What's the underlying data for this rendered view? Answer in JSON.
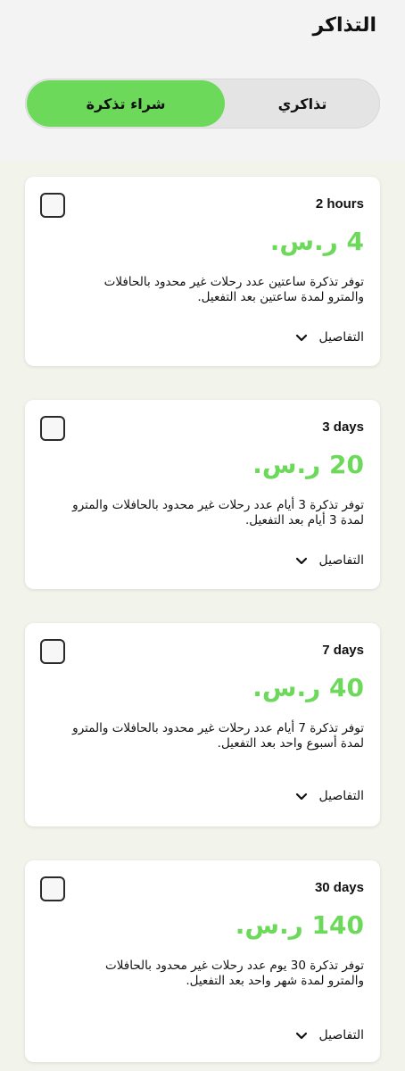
{
  "header": {
    "title": "التذاكر",
    "tabs": {
      "my_tickets": "تذاكري",
      "buy_ticket": "شراء تذكرة"
    },
    "active_tab": "buy_ticket"
  },
  "colors": {
    "accent": "#6cd95a",
    "header_bg": "#f3f3f3",
    "content_bg": "#f2f4ec"
  },
  "tickets": [
    {
      "duration": "2 hours",
      "price": "4 ر.س.",
      "description": "توفر تذكرة ساعتين عدد رحلات غير محدود بالحافلات والمترو لمدة ساعتين بعد التفعيل.",
      "details_label": "التفاصيل",
      "selected": false
    },
    {
      "duration": "3 days",
      "price": "20 ر.س.",
      "description": "توفر تذكرة 3 أيام عدد رحلات غير محدود بالحافلات والمترو لمدة 3 أيام بعد التفعيل.",
      "details_label": "التفاصيل",
      "selected": false
    },
    {
      "duration": "7 days",
      "price": "40 ر.س.",
      "description": "توفر تذكرة 7 أيام عدد رحلات غير محدود بالحافلات والمترو لمدة أسبوع واحد بعد التفعيل.",
      "details_label": "التفاصيل",
      "selected": false
    },
    {
      "duration": "30 days",
      "price": "140 ر.س.",
      "description": "توفر تذكرة 30 يوم عدد رحلات غير محدود بالحافلات والمترو لمدة شهر واحد بعد التفعيل.",
      "details_label": "التفاصيل",
      "selected": false
    }
  ]
}
